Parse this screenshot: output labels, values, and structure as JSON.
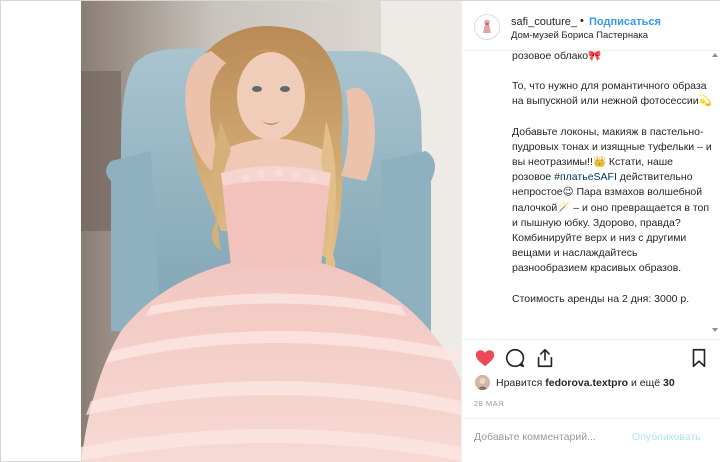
{
  "post": {
    "username": "safi_couture_",
    "separator": "•",
    "follow_label": "Подписаться",
    "location": "Дом-музей Бориса Пастернака",
    "caption": {
      "line_top": "розовое облако🎀",
      "para2": "То, что нужно для романтичного образа на выпускной или нежной фотосессии💫",
      "para3_before": "Добавьте локоны, макияж в пастельно-пудровых тонах и изящные туфельки – и вы неотразимы!!👑 Кстати, наше розовое ",
      "para3_hashtag": "#платьеSAFI",
      "para3_after": " действительно непростое😉 Пара взмахов волшебной палочкой🪄 – и оно превращается в топ и пышную юбку. Здорово, правда? Комбинируйте верх и низ с другими вещами и наслаждайтесь разнообразием красивых образов.",
      "para4": "Стоимость аренды на 2 дня: 3000 р."
    },
    "likes": {
      "prefix": "Нравится ",
      "user": "fedorova.textpro",
      "middle": " и ещё ",
      "count": "30"
    },
    "date": "28 МАЯ",
    "comment": {
      "placeholder": "Добавьте комментарий...",
      "publish_label": "Опубликовать"
    }
  },
  "icons": {
    "like": "heart-icon",
    "comment": "comment-icon",
    "share": "share-icon",
    "save": "bookmark-icon"
  },
  "colors": {
    "link_blue": "#3897f0",
    "heart_red": "#ed4956",
    "hashtag": "#003569",
    "publish_disabled": "#b2dffc"
  }
}
